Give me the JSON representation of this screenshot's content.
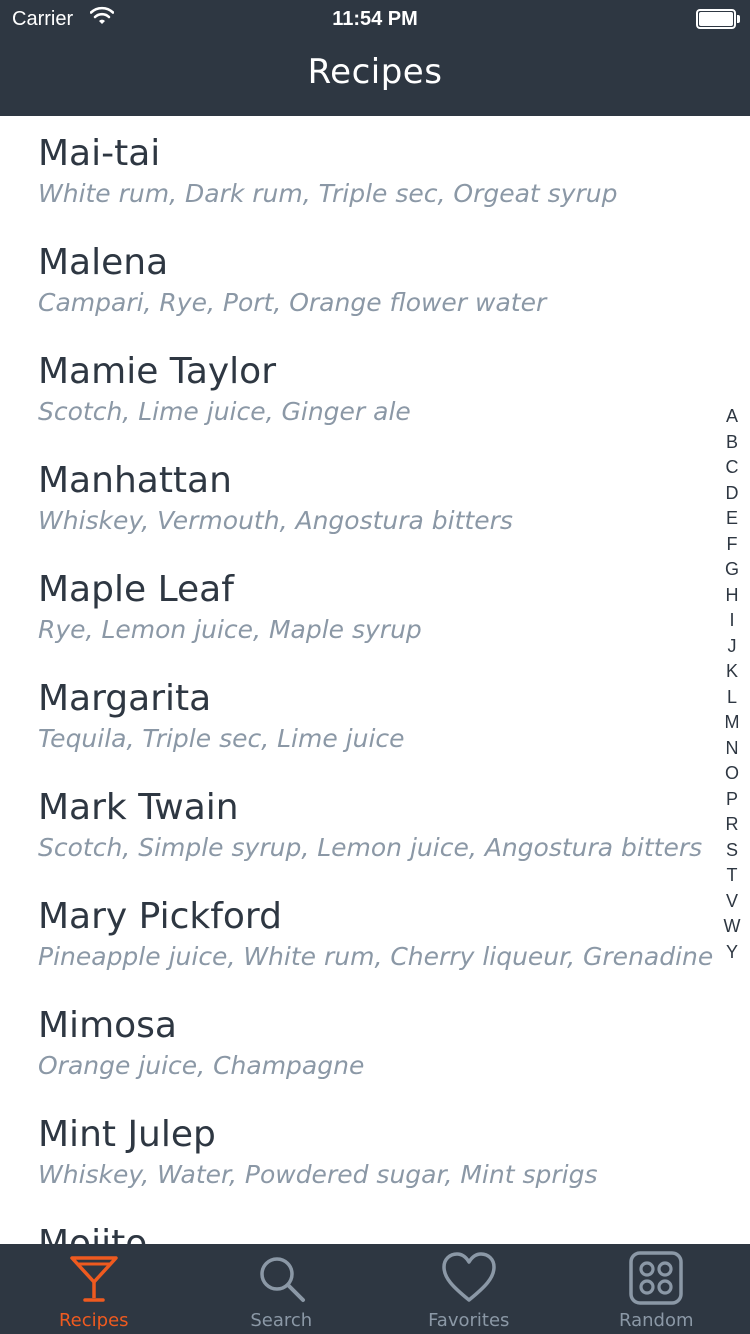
{
  "status_bar": {
    "carrier": "Carrier",
    "time": "11:54 PM"
  },
  "nav": {
    "title": "Recipes"
  },
  "recipes": [
    {
      "name": "Mai-tai",
      "ingredients": "White rum, Dark rum, Triple sec, Orgeat syrup"
    },
    {
      "name": "Malena",
      "ingredients": "Campari, Rye, Port, Orange flower water"
    },
    {
      "name": "Mamie Taylor",
      "ingredients": "Scotch, Lime juice, Ginger ale"
    },
    {
      "name": "Manhattan",
      "ingredients": "Whiskey, Vermouth, Angostura bitters"
    },
    {
      "name": "Maple Leaf",
      "ingredients": "Rye, Lemon juice, Maple syrup"
    },
    {
      "name": "Margarita",
      "ingredients": "Tequila, Triple sec, Lime juice"
    },
    {
      "name": "Mark Twain",
      "ingredients": "Scotch, Simple syrup, Lemon juice, Angostura bitters"
    },
    {
      "name": "Mary Pickford",
      "ingredients": "Pineapple juice, White rum, Cherry liqueur, Grenadine"
    },
    {
      "name": "Mimosa",
      "ingredients": "Orange juice, Champagne"
    },
    {
      "name": "Mint Julep",
      "ingredients": "Whiskey, Water, Powdered sugar, Mint sprigs"
    },
    {
      "name": "Mojito",
      "ingredients": ""
    }
  ],
  "index_letters": [
    "A",
    "B",
    "C",
    "D",
    "E",
    "F",
    "G",
    "H",
    "I",
    "J",
    "K",
    "L",
    "M",
    "N",
    "O",
    "P",
    "R",
    "S",
    "T",
    "V",
    "W",
    "Y"
  ],
  "tabs": [
    {
      "label": "Recipes",
      "icon": "cocktail-glass-icon",
      "active": true
    },
    {
      "label": "Search",
      "icon": "search-icon",
      "active": false
    },
    {
      "label": "Favorites",
      "icon": "heart-icon",
      "active": false
    },
    {
      "label": "Random",
      "icon": "dice-icon",
      "active": false
    }
  ],
  "colors": {
    "bar": "#2e3742",
    "accent": "#ef5a1f",
    "muted": "#8b98a6",
    "text": "#2e3742"
  }
}
